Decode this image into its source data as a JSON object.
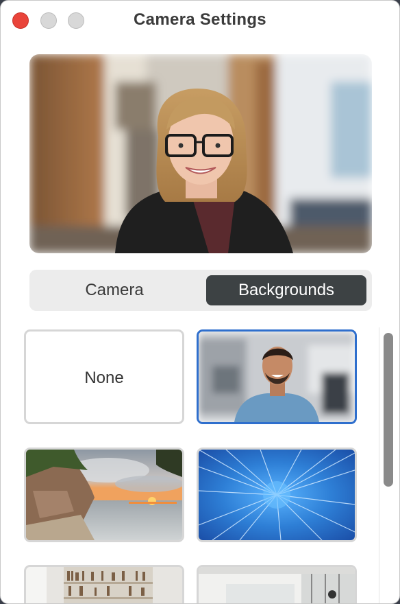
{
  "window": {
    "title": "Camera Settings",
    "traffic_lights": [
      "close",
      "minimize",
      "zoom"
    ]
  },
  "preview": {
    "description_icon": "camera-preview"
  },
  "segmented_control": {
    "tabs": [
      {
        "label": "Camera",
        "selected": false
      },
      {
        "label": "Backgrounds",
        "selected": true
      }
    ]
  },
  "backgrounds": {
    "none_label": "None",
    "selected": "blurred-office-person"
  },
  "colors": {
    "close": "#e9443a",
    "accent": "#2f6fcd",
    "segment_selected": "#3d4244"
  }
}
